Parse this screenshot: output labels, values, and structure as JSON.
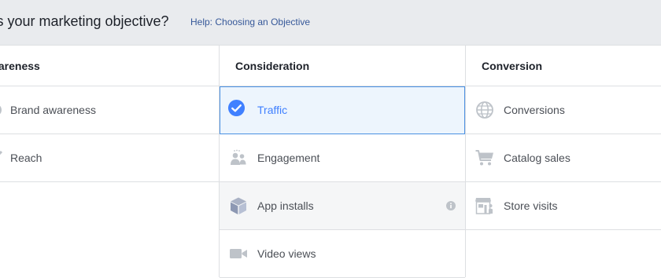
{
  "header": {
    "question": "at's your marketing objective?",
    "help_link": "Help: Choosing an Objective"
  },
  "columns": [
    {
      "title": "wareness",
      "items": [
        {
          "label": "Brand awareness",
          "icon": "brand-awareness-icon"
        },
        {
          "label": "Reach",
          "icon": "reach-icon"
        }
      ]
    },
    {
      "title": "Consideration",
      "items": [
        {
          "label": "Traffic",
          "icon": "checkmark-circle-icon",
          "state": "selected"
        },
        {
          "label": "Engagement",
          "icon": "people-icon"
        },
        {
          "label": "App installs",
          "icon": "cube-icon",
          "state": "hover",
          "info": "info-icon"
        },
        {
          "label": "Video views",
          "icon": "video-camera-icon"
        }
      ]
    },
    {
      "title": "Conversion",
      "items": [
        {
          "label": "Conversions",
          "icon": "globe-icon"
        },
        {
          "label": "Catalog sales",
          "icon": "shopping-cart-icon"
        },
        {
          "label": "Store visits",
          "icon": "store-icon"
        }
      ]
    }
  ],
  "colors": {
    "accent": "#4080ff",
    "selected_bg": "#edf5fd",
    "selected_border": "#4a90e2",
    "icon_gray": "#bec3c9",
    "header_bg": "#e9ebee",
    "link": "#365899"
  }
}
